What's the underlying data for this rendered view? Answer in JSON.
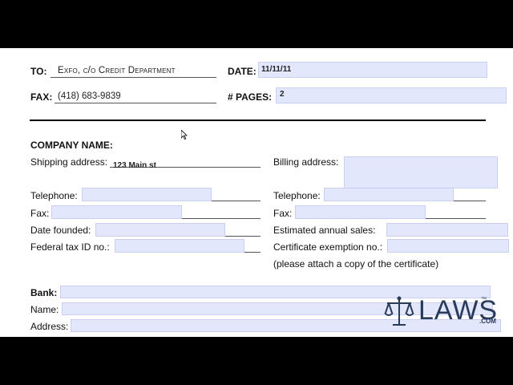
{
  "header": {
    "to_label": "TO:",
    "to_value": "Exfo, c/o Credit Department",
    "date_label": "DATE:",
    "date_value": "11/11/11",
    "fax_label": "FAX:",
    "fax_value": "(418) 683-9839",
    "pages_label": "# PAGES:",
    "pages_value": "2"
  },
  "company": {
    "title": "COMPANY NAME:",
    "shipping_label": "Shipping address:",
    "shipping_value": "123 Main st",
    "billing_label": "Billing address:",
    "telephone_left_label": "Telephone:",
    "telephone_right_label": "Telephone:",
    "fax_left_label": "Fax:",
    "fax_right_label": "Fax:",
    "date_founded_label": "Date founded:",
    "est_sales_label": "Estimated annual sales:",
    "federal_tax_label": "Federal tax ID no.:",
    "cert_exempt_label": "Certificate exemption no.:",
    "cert_note": "(please attach a copy of the certificate)"
  },
  "bank": {
    "bank_label": "Bank:",
    "name_label": "Name:",
    "address_label": "Address:"
  },
  "watermark": {
    "text": "LAWS",
    "tm": "™",
    "com": ".COM",
    "icon": "scales-of-justice-icon"
  }
}
